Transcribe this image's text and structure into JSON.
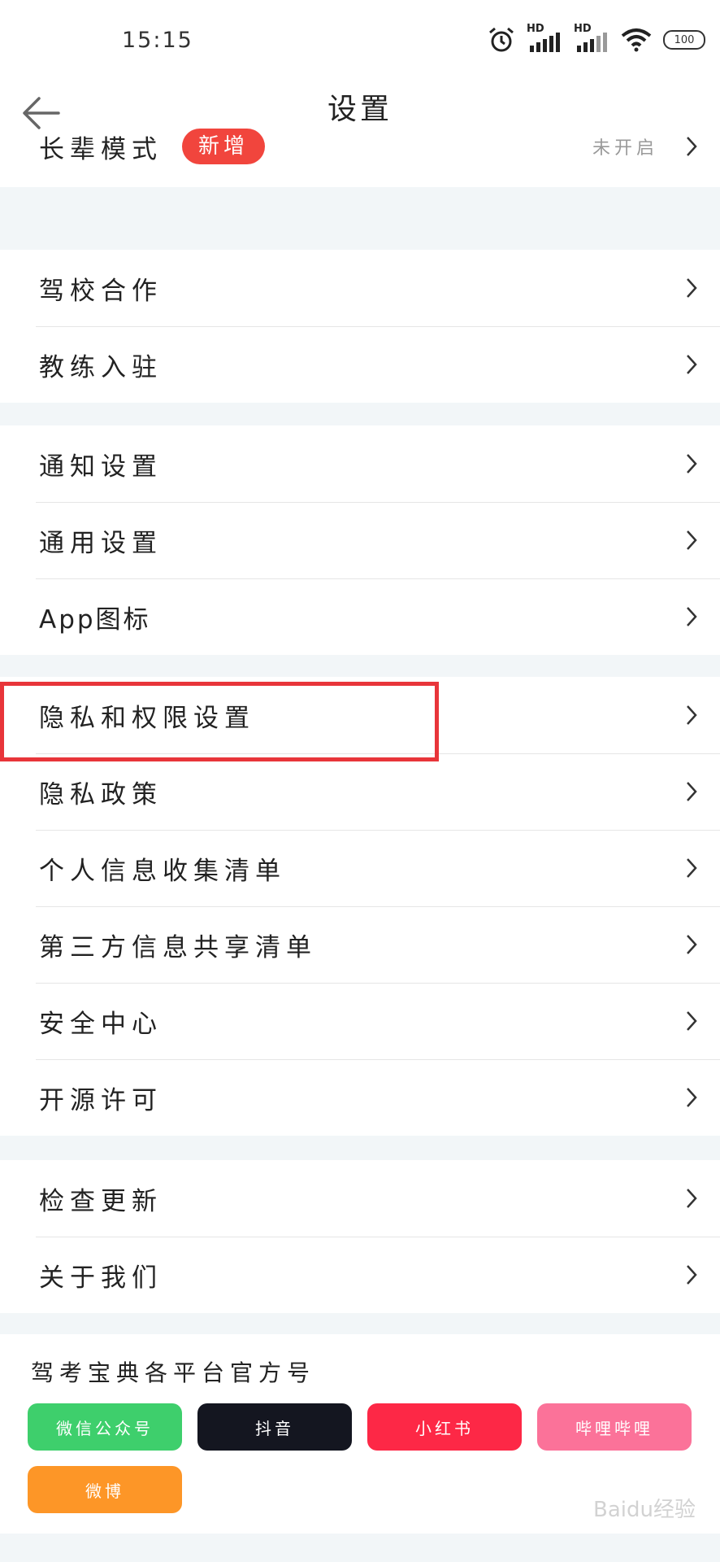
{
  "status_bar": {
    "time": "15:15",
    "hd1": "HD",
    "hd2": "HD",
    "battery": "100"
  },
  "header": {
    "title": "设置"
  },
  "elder_mode": {
    "label": "长辈模式",
    "badge": "新增",
    "value": "未开启"
  },
  "groups": [
    {
      "items": [
        "驾校合作",
        "教练入驻"
      ]
    },
    {
      "items": [
        "通知设置",
        "通用设置",
        "App图标"
      ]
    },
    {
      "items": [
        "隐私和权限设置",
        "隐私政策",
        "个人信息收集清单",
        "第三方信息共享清单",
        "安全中心",
        "开源许可"
      ]
    },
    {
      "items": [
        "检查更新",
        "关于我们"
      ]
    }
  ],
  "footer": {
    "title": "驾考宝典各平台官方号",
    "platforms": [
      {
        "label": "微信公众号",
        "color": "#3ecf6c"
      },
      {
        "label": "抖音",
        "color": "#141620"
      },
      {
        "label": "小红书",
        "color": "#fd2846"
      },
      {
        "label": "哔哩哔哩",
        "color": "#fb7299"
      },
      {
        "label": "微博",
        "color": "#fd9627"
      }
    ]
  },
  "highlight_color": "#e8353a",
  "watermark": "Baidu经验"
}
